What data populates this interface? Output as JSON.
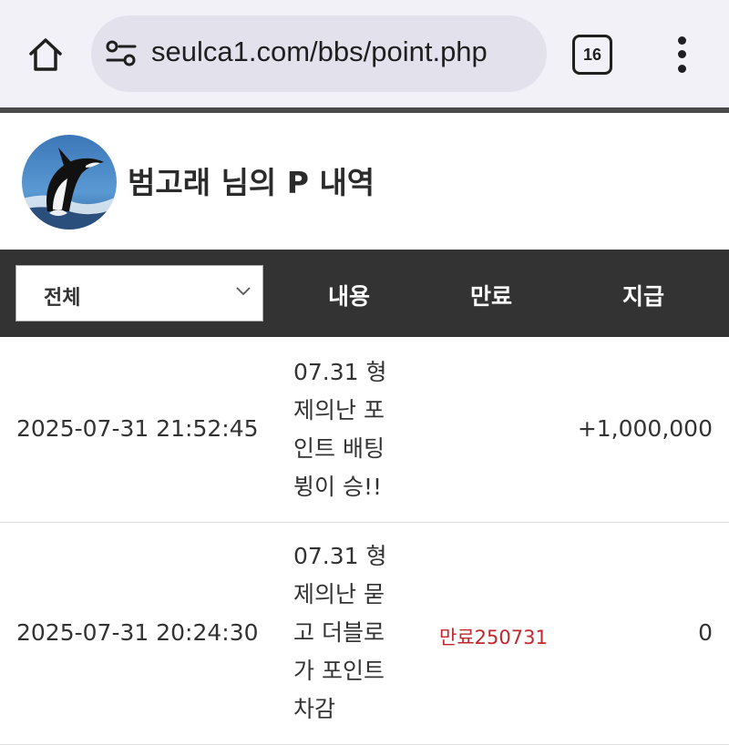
{
  "browser": {
    "url": "seulca1.com/bbs/point.php",
    "tab_count": "16",
    "icons": {
      "home": "home-icon",
      "site_info": "tune-icon",
      "tabs": "tab-switcher-icon",
      "menu": "more-vert-icon"
    }
  },
  "profile": {
    "title": "범고래 님의 P 내역",
    "avatar": "orca-avatar"
  },
  "table": {
    "filter": {
      "selected": "전체"
    },
    "headers": {
      "content": "내용",
      "expire": "만료",
      "amount": "지급"
    },
    "rows": [
      {
        "datetime": "2025-07-31 21:52:45",
        "content_lines": [
          "07.31 형",
          "제의난 포",
          "인트 배팅",
          "뷩이 승!!"
        ],
        "expire": "",
        "amount": "+1,000,000"
      },
      {
        "datetime": "2025-07-31 20:24:30",
        "content_lines": [
          "07.31 형",
          "제의난 묻",
          "고 더블로",
          "가 포인트",
          "차감"
        ],
        "expire": "만료250731",
        "amount": "0"
      }
    ]
  },
  "colors": {
    "chrome_bg": "#f2f1f7",
    "urlbar_bg": "#e3e2ec",
    "header_bg": "#333333",
    "expire_red": "#c1272d"
  }
}
